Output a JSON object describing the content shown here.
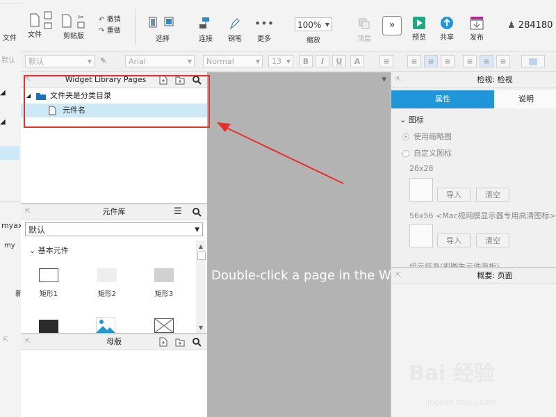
{
  "back_window": {
    "file_label": "文件",
    "default_label": "默认",
    "project_frag": "myax",
    "project_frag2": "my",
    "frag_char": "新"
  },
  "toolbar": {
    "file_label": "文件",
    "clipboard_label": "剪贴版",
    "undo_label": "撤销",
    "redo_label": "重做",
    "select_label": "选择",
    "connect_label": "连接",
    "pen_label": "钢笔",
    "more_label": "更多",
    "zoom_value": "100%",
    "zoom_label": "缩放",
    "top_label": "顶层",
    "preview_label": "预览",
    "share_label": "共享",
    "publish_label": "发布",
    "user_id": "284180"
  },
  "format_bar": {
    "style_value": "默认",
    "font_value": "Arial",
    "weight_value": "Normal",
    "size_value": "13",
    "bold": "B",
    "italic": "I",
    "underline": "U"
  },
  "pages_panel": {
    "title": "Widget Library Pages",
    "folder_label": "文件夹是分类目录",
    "page_label": "元件名"
  },
  "widget_panel": {
    "title": "元件库",
    "library_value": "默认",
    "section_label": "基本元件",
    "widgets": [
      "矩形1",
      "矩形2",
      "矩形3"
    ]
  },
  "master_panel": {
    "title": "母版"
  },
  "canvas": {
    "message": "Double-click a page in the Wi"
  },
  "inspector": {
    "title": "检视: 检视",
    "tab_properties": "属性",
    "tab_notes": "说明",
    "icon_section": "图标",
    "use_thumbnail": "使用缩略图",
    "custom_icon": "自定义图标",
    "size_small": "28x28",
    "size_large": "56x56 <Mac视网膜显示器专用高清图标>",
    "import_label": "导入",
    "clear_label": "清空",
    "cut_text": "组元信息(视图生元件面板)"
  },
  "overview": {
    "title": "概要: 页面"
  },
  "watermark": {
    "brand": "Bai 经验",
    "url": "jingyan.baidu.com"
  },
  "colors": {
    "accent_blue": "#1e96d8",
    "selection": "#cde8f7",
    "highlight_red": "#e8302a",
    "canvas_gray": "#b3b3b3"
  }
}
